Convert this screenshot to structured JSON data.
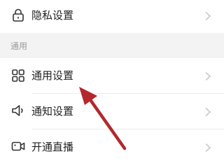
{
  "menu": {
    "privacy": {
      "label": "隐私设置",
      "icon": "lock-icon"
    },
    "section_title": "通用",
    "general": {
      "label": "通用设置",
      "icon": "grid-icon"
    },
    "notification": {
      "label": "通知设置",
      "icon": "speaker-icon"
    },
    "live": {
      "label": "开通直播",
      "icon": "video-camera-icon"
    }
  },
  "colors": {
    "annotation_arrow": "#b3282d",
    "icon": "#333333",
    "chevron": "#c2c2c2",
    "section_background": "#f3f3f3"
  }
}
